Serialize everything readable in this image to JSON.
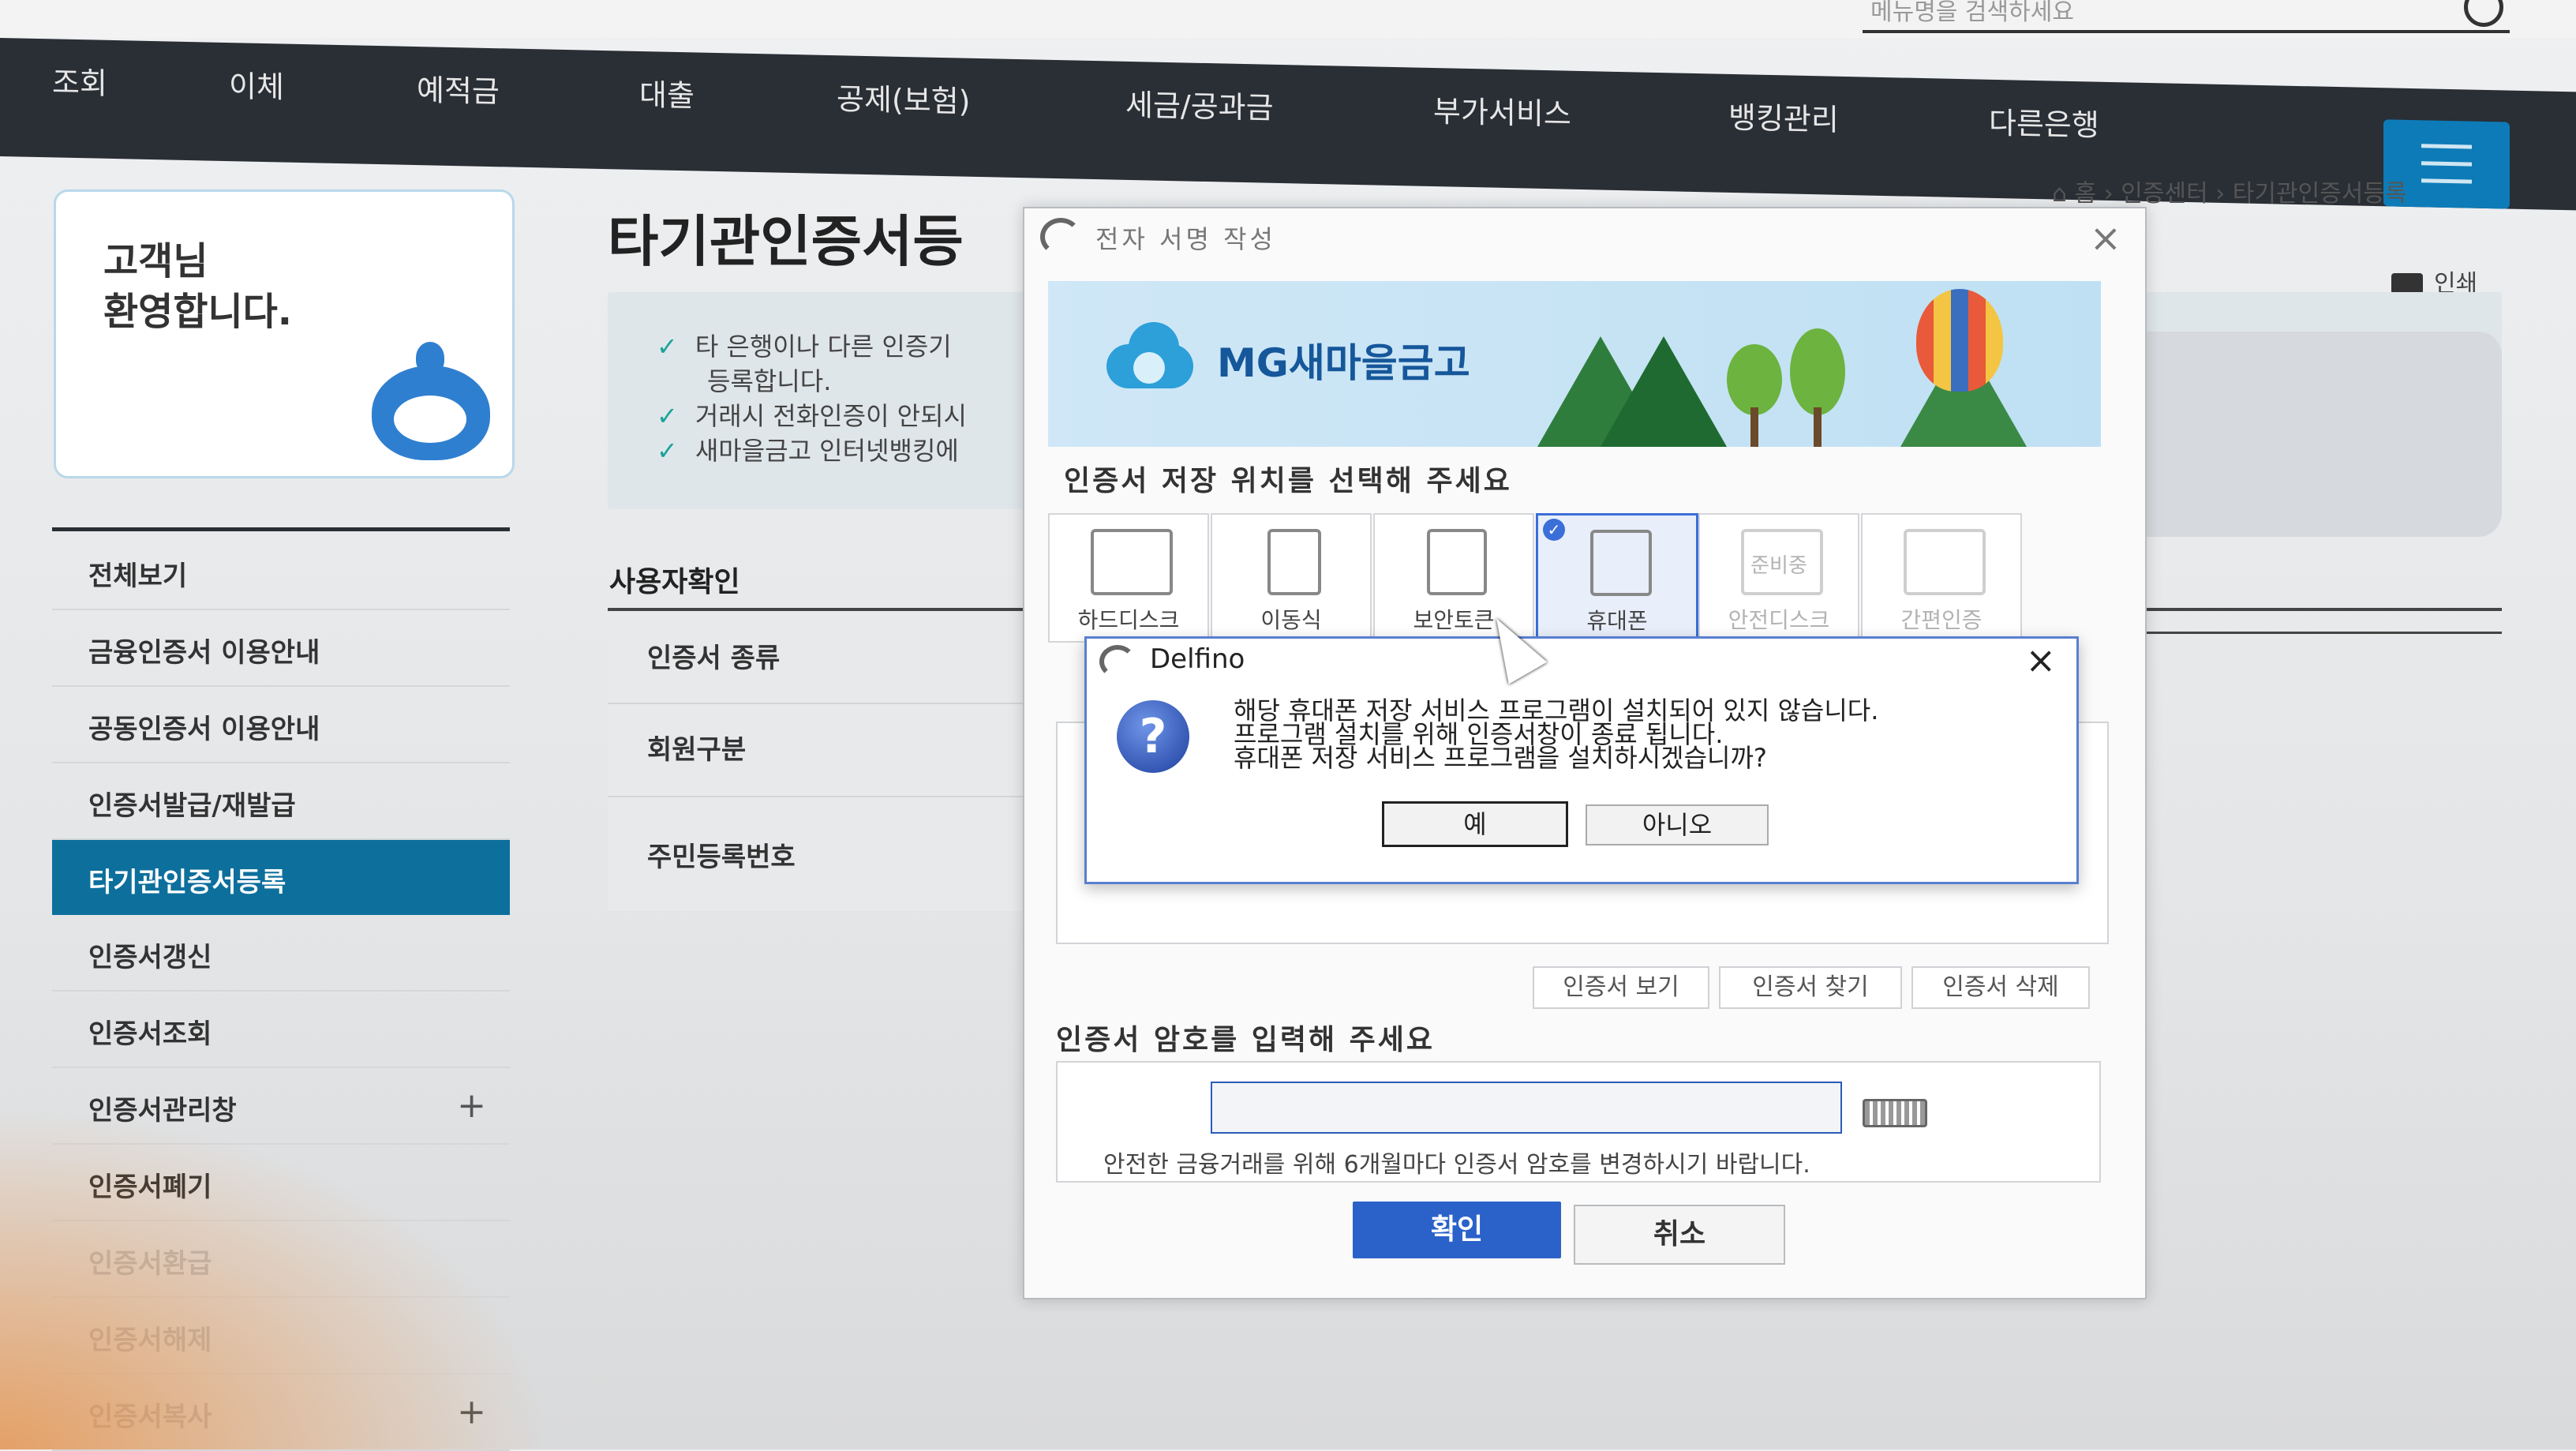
{
  "search": {
    "placeholder": "메뉴명을 검색하세요"
  },
  "nav": {
    "items": [
      "조회",
      "이체",
      "예적금",
      "대출",
      "공제(보험)",
      "세금/공과금",
      "부가서비스",
      "뱅킹관리",
      "다른은행"
    ],
    "accent": "#0d7bb7"
  },
  "welcome": {
    "text": "고객님\n환영합니다."
  },
  "sidebar": {
    "items": [
      {
        "label": "전체보기"
      },
      {
        "label": "금융인증서 이용안내"
      },
      {
        "label": "공동인증서 이용안내"
      },
      {
        "label": "인증서발급/재발급"
      },
      {
        "label": "타기관인증서등록"
      },
      {
        "label": "인증서갱신"
      },
      {
        "label": "인증서조회"
      },
      {
        "label": "인증서관리창"
      },
      {
        "label": "인증서폐기"
      },
      {
        "label": "인증서환급"
      },
      {
        "label": "인증서해제"
      },
      {
        "label": "인증서복사"
      }
    ],
    "active_index": 4,
    "active_color": "#0d6f9c"
  },
  "main": {
    "title": "타기관인증서등",
    "breadcrumb": [
      "홈",
      "인증센터",
      "타기관인증서등록"
    ],
    "print_label": "인쇄",
    "notice": [
      "타 은행이나 다른 인증기",
      "등록합니다.",
      "거래시 전화인증이 안되시",
      "새마을금고 인터넷뱅킹에"
    ],
    "section_title": "사용자확인",
    "form_labels": [
      "인증서 종류",
      "회원구분",
      "주민등록번호"
    ]
  },
  "signing": {
    "window_title": "전자 서명 작성",
    "brand": "MG새마을금고",
    "prompt_location": "인증서 저장 위치를 선택해 주세요",
    "locations": [
      {
        "label": "하드디스크",
        "icon": "monitor-icon",
        "selected": false,
        "disabled": false
      },
      {
        "label": "이동식",
        "icon": "usb-icon",
        "selected": false,
        "disabled": false
      },
      {
        "label": "보안토큰",
        "icon": "lock-icon",
        "selected": false,
        "disabled": false
      },
      {
        "label": "휴대폰",
        "icon": "phone-icon",
        "selected": true,
        "disabled": false
      },
      {
        "label": "안전디스크",
        "icon": "safedisk-icon",
        "selected": false,
        "disabled": true,
        "tag": "준비중"
      },
      {
        "label": "간편인증",
        "icon": "simple-auth-icon",
        "selected": false,
        "disabled": true
      }
    ],
    "cert_buttons": [
      "인증서 보기",
      "인증서 찾기",
      "인증서 삭제"
    ],
    "prompt_password": "인증서 암호를 입력해 주세요",
    "password_value": "",
    "password_note": "안전한 금융거래를 위해 6개월마다 인증서 암호를 변경하시기 바랍니다.",
    "ok_label": "확인",
    "cancel_label": "취소",
    "ok_color": "#2a62c9"
  },
  "dialog": {
    "title": "Delfino",
    "icon": "question-icon",
    "message": [
      "해당 휴대폰 저장 서비스 프로그램이 설치되어 있지 않습니다.",
      "프로그램 설치를 위해 인증서창이 종료 됩니다.",
      "휴대폰 저장 서비스 프로그램을 설치하시겠습니까?"
    ],
    "yes_label": "예",
    "no_label": "아니오"
  }
}
